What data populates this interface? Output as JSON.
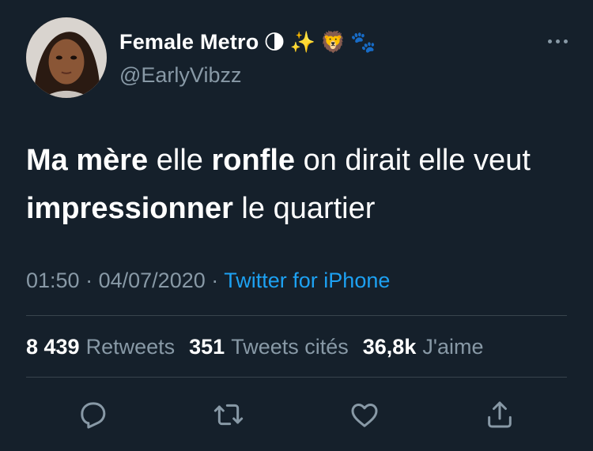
{
  "user": {
    "display_name": "Female Metro",
    "emojis": [
      "🌗",
      "✨",
      "🦁",
      "🐾"
    ],
    "handle": "@EarlyVibzz"
  },
  "tweet": {
    "segments": [
      {
        "text": "Ma mère",
        "bold": true
      },
      {
        "text": " elle ",
        "bold": false
      },
      {
        "text": "ronfle",
        "bold": true
      },
      {
        "text": " on dirait elle veut ",
        "bold": false
      },
      {
        "text": "impressionner",
        "bold": true
      },
      {
        "text": " le quartier",
        "bold": false
      }
    ]
  },
  "meta": {
    "time": "01:50",
    "separator": "·",
    "date": "04/07/2020",
    "source": "Twitter for iPhone"
  },
  "stats": {
    "retweets_count": "8 439",
    "retweets_label": "Retweets",
    "quotes_count": "351",
    "quotes_label": "Tweets cités",
    "likes_count": "36,8k",
    "likes_label": "J'aime"
  },
  "actions": [
    "reply-icon",
    "retweet-icon",
    "like-icon",
    "share-icon"
  ],
  "colors": {
    "background": "#15202b",
    "text": "#ffffff",
    "secondary": "#8899a6",
    "link": "#1da1f2",
    "divider": "#38444d"
  }
}
